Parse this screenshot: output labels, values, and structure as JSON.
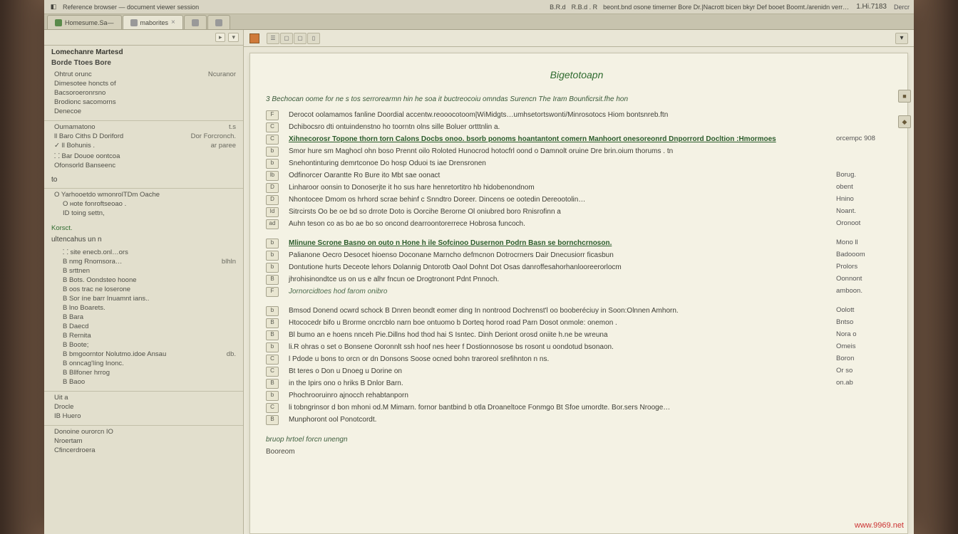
{
  "colors": {
    "accent_green": "#2f6b2f",
    "panel_bg": "#e2dfcd",
    "doc_bg": "#f4f2e4"
  },
  "topbar": {
    "title_long": "Reference browser — document viewer session",
    "stats": [
      "B.R.d",
      "R.B.d . R",
      "beont.bnd  osone timerner  Bore Dr.|Nacrott  bicen bkyr Def booet  Boomt./arenidn verr…"
    ],
    "clock": "1.Hi.7183",
    "tray": "Dercr"
  },
  "tabs": [
    {
      "label": "Homesume.Sa—",
      "active": false,
      "icon": "gr"
    },
    {
      "label": "maborites",
      "active": true,
      "icon": "gy"
    },
    {
      "label": "",
      "active": false,
      "icon": "gy"
    },
    {
      "label": "",
      "active": false,
      "icon": "gy"
    }
  ],
  "sidebar": {
    "toolbar": {
      "action_icon": "▸",
      "dropdown_icon": "▾"
    },
    "panel1": {
      "title": "Lomechanre  Martesd",
      "subtitle": "Borde Ttoes Bore",
      "items": [
        {
          "label": "Ohtrut orunc",
          "value": "Ncuranor"
        },
        {
          "label": "Dimesotee honcts of"
        },
        {
          "label": "Bacsoroeronrsno"
        },
        {
          "label": "Brodionc sacomorns"
        },
        {
          "label": "Denecoe"
        }
      ]
    },
    "panel2": {
      "rows": [
        {
          "left": "Oumamatono",
          "right": "t.s"
        },
        {
          "left": "ll  Baro Ciths D Doriford",
          "right": "Dor Forcronch."
        },
        {
          "left": "ll Bohunis  .",
          "right": "ar paree",
          "check": true
        },
        {
          "left": "⸬ Bar Douoe  oontcoa"
        },
        {
          "left": "Ofonsorld Banseenc"
        }
      ],
      "action": "to"
    },
    "panel3": {
      "rows": [
        {
          "label": "O Yarhooetdo  wmonrolTDm Oache",
          "indent": 0
        },
        {
          "label": "O  ʜote  fonroftseoao .",
          "indent": 1
        },
        {
          "label": "ID toing settn,",
          "indent": 1
        }
      ],
      "link": "Korsct.",
      "subheader": "ultencahus un n",
      "items": [
        {
          "label": "⸬ site enecb.onl…ors",
          "value": ""
        },
        {
          "label": "B  nmg  Rnomsora…",
          "value": "blhln"
        },
        {
          "label": "B  srttnen"
        },
        {
          "label": "B  Bots. Oondsteo hoone"
        },
        {
          "label": "B  oos  trac ne loserone"
        },
        {
          "label": "B  Sor íne  barr Inuamnt ians.."
        },
        {
          "label": "B  lno  Boarets."
        },
        {
          "label": "B  Bara"
        },
        {
          "label": "B  Daecd"
        },
        {
          "label": "B  Rernita"
        },
        {
          "label": "B  Boote;"
        },
        {
          "label": "B  bmgoorntor  Nolutmo.idoe  Ansau",
          "value": "db."
        },
        {
          "label": "B  onncag'líng Inonc."
        },
        {
          "label": "B  Bllfoner hrrog"
        },
        {
          "label": "B  Baoo"
        }
      ]
    },
    "panel4": {
      "items": [
        {
          "label": "Uit a"
        },
        {
          "label": "Drocle"
        },
        {
          "label": "IB Huero"
        }
      ]
    },
    "panel5": {
      "items": [
        {
          "label": "Donoine ourorcn IO"
        },
        {
          "label": "Nroertam"
        },
        {
          "label": "Cfincerdroera"
        }
      ]
    }
  },
  "main": {
    "toolbar": {
      "icons": [
        "☰",
        "▢",
        "▢",
        "▯"
      ]
    },
    "doc": {
      "title": "Bigetotoapn",
      "header_line": "3 Bechocan oome  for ne s tos serrorearmn hin he soa it buctreocoiu omndas  Surencn The Iram Bounficrsit.fhe hon",
      "entries": [
        {
          "badge": "F",
          "text": "Derocot oolamamos fanline Doordial accentw.reooocotoom|WiMidgts…umhsetortswonti/Minrosotocs Hiom bontsnreb.ftn",
          "right": "",
          "kind": "norm"
        },
        {
          "badge": "C",
          "text": "Dchibocsro dti ontuindenstno ho toorntn olns sille  Boluer ortttnlin a.",
          "right": "",
          "kind": "norm"
        },
        {
          "badge": "C",
          "text": "Xihnecorosr  Topone thorn torn Calons Docbs onoo. bsorb ponoms hoantantont comern  Manhoort onesoreonrd  Dnporrord Docltion :Hmormoes",
          "right": "orcempc  908",
          "kind": "heading"
        },
        {
          "badge": "b",
          "text": "Smor hure sm Maghocl ohn boso  Prennt oilo  Roloted  Hunocrod hotocfrl oond o Damnolt oruine Dre brin.oium  thorums .   tn",
          "right": "",
          "kind": "norm"
        },
        {
          "badge": "b",
          "text": "Snehontinturing demrtconoe  Do hosp  Oduoi ts iae Drensronen",
          "right": "",
          "kind": "norm"
        },
        {
          "badge": "lb",
          "text": "Odfinorcer Oarantte Ro Bure ito Mbt sae oonact",
          "right": "Borug.",
          "kind": "norm"
        },
        {
          "badge": "D",
          "text": "Linharoor oonsin  to  Donoserjte it ho  sus hare henretortitro hb hidobenondnom",
          "right": "obent",
          "kind": "norm"
        },
        {
          "badge": "D",
          "text": "Nhontocee  Dmom  os hrhord scrae behinf c Snndtro Doreer. Dincens oe  ootedin  Dereootolin…",
          "right": "Hnino",
          "kind": "norm"
        },
        {
          "badge": "Id",
          "text": "Sitrcirsts  Oo be  oe bd so drrote Doto  is Oorcihe  Berorne Ol oniubred boro Rnisrofinn a",
          "right": "Noant.",
          "kind": "norm"
        },
        {
          "badge": "ad",
          "text": "Auhn teson co as  bo ae bo so oncond  dearroontorerrece Hobrosa  funcoch.",
          "right": "Oronoot",
          "kind": "norm"
        },
        {
          "badge": "",
          "text": "",
          "right": "",
          "kind": "gap"
        },
        {
          "badge": "b",
          "text": "Mlinune  Scrone Basno  on outo n Hone h ile Sofcinoo  Dusernon  Podrn  Basn se bornchcrnoson.",
          "right": "Mono ll",
          "kind": "heading"
        },
        {
          "badge": "b",
          "text": "Palianone Oecro Desocet hioenso Doconane Marncho defmcnon Dotrocrners Dair Dnecusiorr ficasbun",
          "right": "Badooom",
          "kind": "norm"
        },
        {
          "badge": "b",
          "text": "Dontutione hurts Deceote  lehors Dolannig  Dntorotb Oaol Dohnt Dot Osas  danroffesahorhanlooreerorlocm",
          "right": "Prolors",
          "kind": "norm"
        },
        {
          "badge": "B",
          "text": "jhrohisinondtce  us  on us e alhr  fncun oe Drogtronont Pdnt Pnnoch.",
          "right": "Oonnont",
          "kind": "norm"
        },
        {
          "badge": "F",
          "text": "Jornorcidtoes hod  farom onibro",
          "right": "amboon.",
          "kind": "sub"
        },
        {
          "badge": "",
          "text": "",
          "right": "",
          "kind": "gap"
        },
        {
          "badge": "b",
          "text": "Bmsod  Donend ocwrd schock B Dnren beondt eomer ding In nontrood  Dochrenst'l  oo  booberéciuy in Soon:Olnnen Amhorn.",
          "right": "Oolott",
          "kind": "norm"
        },
        {
          "badge": "B",
          "text": "Htococedr bifo u Brorme oncrcblo narn boe ontuomo b Dorteq horod road Parn Dosot onmole: onemon .",
          "right": "Bntso",
          "kind": "norm"
        },
        {
          "badge": "B",
          "text": "Bl bumo an e hoens nnceh  Pie.Dillns hod thod hai S Isntec.  Dinh Deriont orosd oniite h.ne be wreuna",
          "right": "Nora o",
          "kind": "norm"
        },
        {
          "badge": "b",
          "text": "li.R  ohras o set o Bonsene Ooronnlt ssh hoof nes heer f Dostionnosose bs rosont u oondotud bsonaon.",
          "right": "Omeis",
          "kind": "norm"
        },
        {
          "badge": "C",
          "text": "l Pdode u bons to orcn  or  dn Donsons Soose ocned bohn traroreol srefihnton n ns.",
          "right": "Boron",
          "kind": "norm"
        },
        {
          "badge": "C",
          "text": "Bt teres o Don u Dnoeg u Dorine  on",
          "right": "Or so",
          "kind": "norm"
        },
        {
          "badge": "B",
          "text": "in the Ipirs  ono o hriks B Dnlor Barn.",
          "right": "on.ab",
          "kind": "norm"
        },
        {
          "badge": "b",
          "text": "Phochrooruinro  ajnocch rehabtanporn",
          "right": "",
          "kind": "norm"
        },
        {
          "badge": "C",
          "text": "li tobngrinsor  d bon mhoni od.M Mimarn. fornor bantbind  b otla  Droaneltoce Fonmgo Bt Sfoe umordte. Bor.sers Nrooge…",
          "right": "",
          "kind": "norm"
        },
        {
          "badge": "B",
          "text": "Munphoront ool Ponotcordt.",
          "right": "",
          "kind": "norm"
        }
      ],
      "footer1": "bruop  hrtoel  forcn unengn",
      "footer2": "Booreom"
    }
  },
  "watermark": "www.9969.net"
}
